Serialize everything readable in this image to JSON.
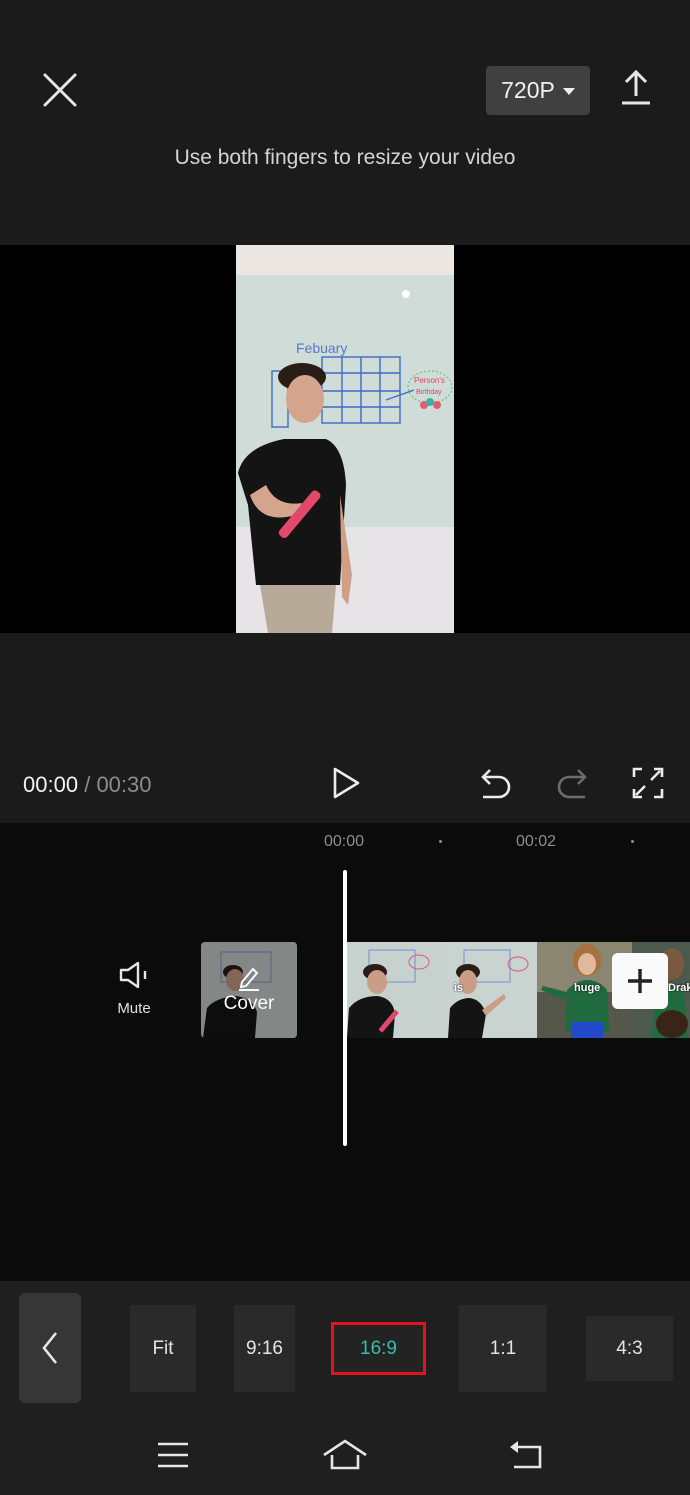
{
  "header": {
    "close_icon": "close-icon",
    "resolution": "720P",
    "export_icon": "upload-icon",
    "hint": "Use both fingers to resize your video"
  },
  "preview": {
    "video_description": "Person in black t-shirt in front of whiteboard calendar",
    "whiteboard_title": "Febuary",
    "whiteboard_note": "Person's Birthday"
  },
  "playback": {
    "current_time": "00:00",
    "separator": "/",
    "duration": "00:30",
    "play_icon": "play-icon",
    "undo_icon": "undo-icon",
    "redo_icon": "redo-icon",
    "fullscreen_icon": "fullscreen-icon"
  },
  "timeline": {
    "ruler": [
      "00:00",
      "00:02"
    ],
    "mute_label": "Mute",
    "cover_label": "Cover",
    "clip_captions": [
      "",
      "is",
      "huge",
      "Drak"
    ],
    "add_icon": "plus-icon"
  },
  "aspect_panel": {
    "back_icon": "chevron-left-icon",
    "options": [
      {
        "label": "Fit",
        "selected": false
      },
      {
        "label": "9:16",
        "selected": false
      },
      {
        "label": "16:9",
        "selected": true
      },
      {
        "label": "1:1",
        "selected": false
      },
      {
        "label": "4:3",
        "selected": false
      }
    ],
    "accent_color": "#35bfae",
    "highlight_color": "#e0141c"
  },
  "navbar": {
    "menu_icon": "menu-icon",
    "home_icon": "home-icon",
    "back_icon": "back-icon"
  }
}
